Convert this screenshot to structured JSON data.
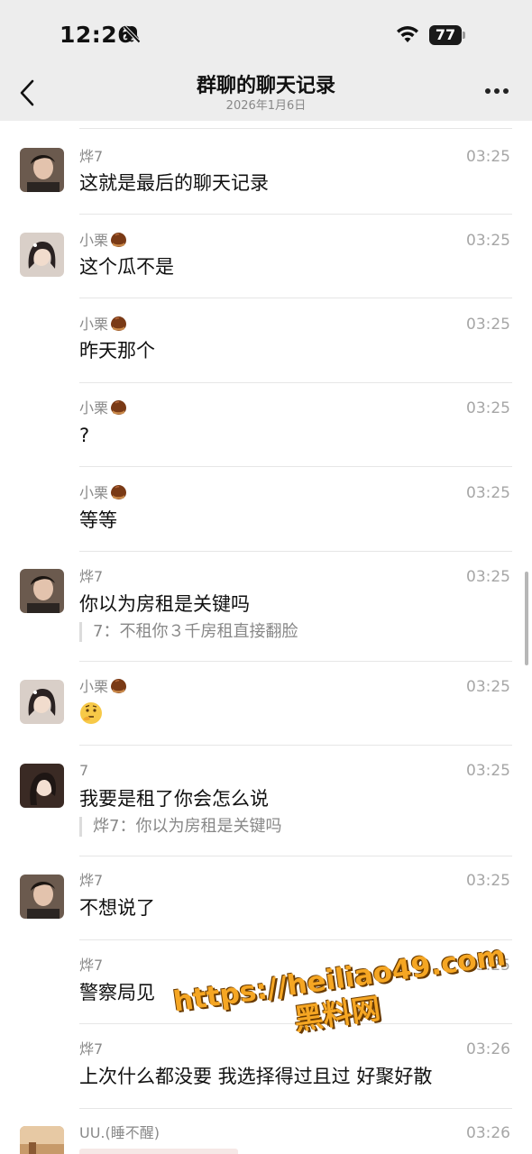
{
  "status_bar": {
    "time": "12:26",
    "battery": "77"
  },
  "header": {
    "title": "群聊的聊天记录",
    "date": "2026年1月6日"
  },
  "messages": [
    {
      "sender": "烨7",
      "time": "03:25",
      "text": "这就是最后的聊天记录"
    },
    {
      "sender": "小栗",
      "time": "03:25",
      "text": "这个瓜不是"
    },
    {
      "sender": "小栗",
      "time": "03:25",
      "text": "昨天那个"
    },
    {
      "sender": "小栗",
      "time": "03:25",
      "text": "?"
    },
    {
      "sender": "小栗",
      "time": "03:25",
      "text": "等等"
    },
    {
      "sender": "烨7",
      "time": "03:25",
      "text": "你以为房租是关键吗",
      "quote": "7：不租你３千房租直接翻脸"
    },
    {
      "sender": "小栗",
      "time": "03:25",
      "text": ""
    },
    {
      "sender": "7",
      "time": "03:25",
      "text": "我要是租了你会怎么说",
      "quote": "烨7：你以为房租是关键吗"
    },
    {
      "sender": "烨7",
      "time": "03:25",
      "text": "不想说了"
    },
    {
      "sender": "烨7",
      "time": "03:25",
      "text": "警察局见"
    },
    {
      "sender": "烨7",
      "time": "03:26",
      "text": "上次什么都没要 我选择得过且过 好聚好散"
    },
    {
      "sender": "UU.(睡不醒)",
      "time": "03:26",
      "text": ""
    }
  ],
  "watermark": {
    "line1": "https://heiliao49.com",
    "line2": "黑料网"
  }
}
